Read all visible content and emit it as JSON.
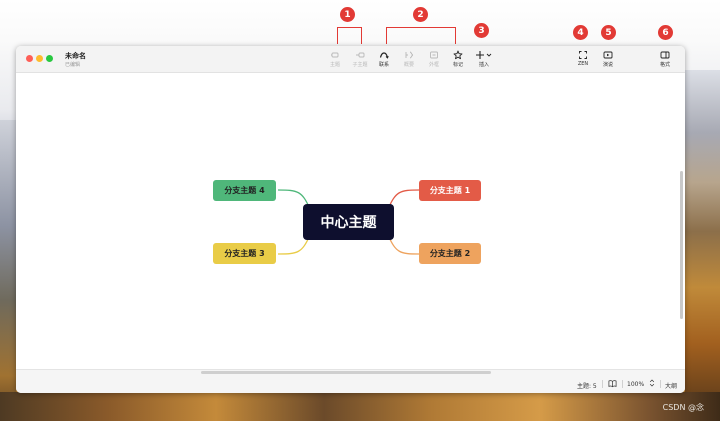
{
  "window": {
    "document_title": "未命名",
    "document_status": "已编辑"
  },
  "toolbar": {
    "items": [
      {
        "label": "主题",
        "icon": "topic-icon",
        "enabled": false
      },
      {
        "label": "子主题",
        "icon": "subtopic-icon",
        "enabled": false
      },
      {
        "label": "联系",
        "icon": "relationship-icon",
        "enabled": true
      },
      {
        "label": "概要",
        "icon": "summary-icon",
        "enabled": false
      },
      {
        "label": "外框",
        "icon": "boundary-icon",
        "enabled": false
      },
      {
        "label": "标记",
        "icon": "star-icon",
        "enabled": true
      },
      {
        "label": "插入",
        "icon": "plus-icon",
        "enabled": true
      },
      {
        "label": "ZEN",
        "icon": "zen-fullscreen-icon",
        "enabled": true
      },
      {
        "label": "演说",
        "icon": "pitch-icon",
        "enabled": true
      },
      {
        "label": "格式",
        "icon": "format-panel-icon",
        "enabled": true
      }
    ]
  },
  "callouts": [
    "1",
    "2",
    "3",
    "4",
    "5",
    "6"
  ],
  "mindmap": {
    "central_topic": "中心主题",
    "branches": [
      {
        "label": "分支主题 1",
        "color": "#e35b47"
      },
      {
        "label": "分支主题 2",
        "color": "#eea35e"
      },
      {
        "label": "分支主题 3",
        "color": "#e9cc47"
      },
      {
        "label": "分支主题 4",
        "color": "#4fb77a"
      }
    ]
  },
  "statusbar": {
    "topic_count": "主题: 5",
    "zoom": "100%",
    "outline": "大纲"
  },
  "watermark": "CSDN @念"
}
